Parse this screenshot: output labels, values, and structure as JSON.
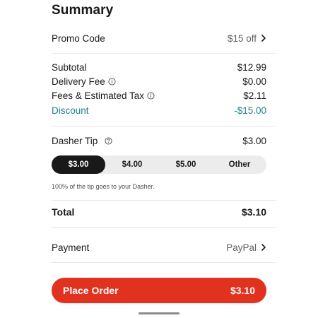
{
  "summary": {
    "title": "Summary"
  },
  "promo": {
    "label": "Promo Code",
    "value": "$15 off"
  },
  "costs": {
    "subtotal": {
      "label": "Subtotal",
      "value": "$12.99"
    },
    "delivery_fee": {
      "label": "Delivery Fee",
      "value": "$0.00"
    },
    "fees_tax": {
      "label": "Fees & Estimated Tax",
      "value": "$2.11"
    },
    "discount": {
      "label": "Discount",
      "value": "-$15.00"
    }
  },
  "tip": {
    "label": "Dasher Tip",
    "value": "$3.00",
    "options": [
      "$3.00",
      "$4.00",
      "$5.00",
      "Other"
    ],
    "selected": "$3.00",
    "note": "100% of the tip goes to your Dasher."
  },
  "total": {
    "label": "Total",
    "value": "$3.10"
  },
  "payment": {
    "label": "Payment",
    "value": "PayPal"
  },
  "place_order": {
    "label": "Place Order",
    "amount": "$3.10"
  },
  "colors": {
    "accent": "#e0321e",
    "discount": "#1d7f86",
    "selected_tip": "#191919"
  },
  "icons": {
    "info": "info-icon",
    "help": "question-icon",
    "chevron": "chevron-right-icon"
  }
}
